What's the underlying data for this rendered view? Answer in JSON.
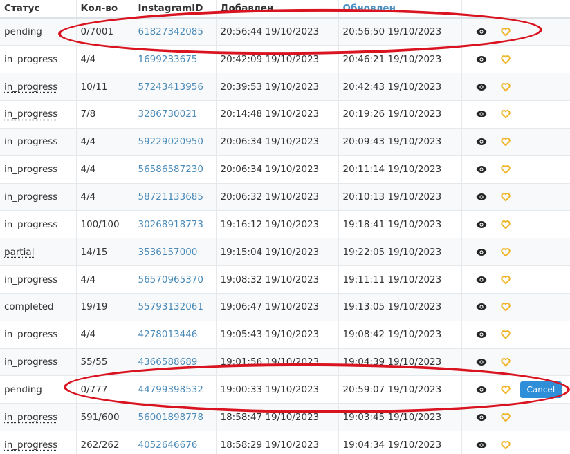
{
  "table": {
    "headers": {
      "status": "Статус",
      "qty": "Кол-во",
      "instagram_id": "InstagramID",
      "added": "Добавлен",
      "updated": "Обновлен"
    },
    "rows": [
      {
        "status": "pending",
        "dotted": false,
        "qty": "0/7001",
        "ig": "61827342085",
        "added": "20:56:44 19/10/2023",
        "updated": "20:56:50 19/10/2023",
        "cancel": false
      },
      {
        "status": "in_progress",
        "dotted": false,
        "qty": "4/4",
        "ig": "1699233675",
        "added": "20:42:09 19/10/2023",
        "updated": "20:46:21 19/10/2023",
        "cancel": false
      },
      {
        "status": "in_progress",
        "dotted": true,
        "qty": "10/11",
        "ig": "57243413956",
        "added": "20:39:53 19/10/2023",
        "updated": "20:42:43 19/10/2023",
        "cancel": false
      },
      {
        "status": "in_progress",
        "dotted": true,
        "qty": "7/8",
        "ig": "3286730021",
        "added": "20:14:48 19/10/2023",
        "updated": "20:19:26 19/10/2023",
        "cancel": false
      },
      {
        "status": "in_progress",
        "dotted": false,
        "qty": "4/4",
        "ig": "59229020950",
        "added": "20:06:34 19/10/2023",
        "updated": "20:09:43 19/10/2023",
        "cancel": false
      },
      {
        "status": "in_progress",
        "dotted": false,
        "qty": "4/4",
        "ig": "56586587230",
        "added": "20:06:34 19/10/2023",
        "updated": "20:11:14 19/10/2023",
        "cancel": false
      },
      {
        "status": "in_progress",
        "dotted": false,
        "qty": "4/4",
        "ig": "58721133685",
        "added": "20:06:32 19/10/2023",
        "updated": "20:10:13 19/10/2023",
        "cancel": false
      },
      {
        "status": "in_progress",
        "dotted": false,
        "qty": "100/100",
        "ig": "30268918773",
        "added": "19:16:12 19/10/2023",
        "updated": "19:18:41 19/10/2023",
        "cancel": false
      },
      {
        "status": "partial",
        "dotted": true,
        "qty": "14/15",
        "ig": "3536157000",
        "added": "19:15:04 19/10/2023",
        "updated": "19:22:05 19/10/2023",
        "cancel": false
      },
      {
        "status": "in_progress",
        "dotted": false,
        "qty": "4/4",
        "ig": "56570965370",
        "added": "19:08:32 19/10/2023",
        "updated": "19:11:11 19/10/2023",
        "cancel": false
      },
      {
        "status": "completed",
        "dotted": false,
        "qty": "19/19",
        "ig": "55793132061",
        "added": "19:06:47 19/10/2023",
        "updated": "19:13:05 19/10/2023",
        "cancel": false
      },
      {
        "status": "in_progress",
        "dotted": false,
        "qty": "4/4",
        "ig": "4278013446",
        "added": "19:05:43 19/10/2023",
        "updated": "19:08:42 19/10/2023",
        "cancel": false
      },
      {
        "status": "in_progress",
        "dotted": false,
        "qty": "55/55",
        "ig": "4366588689",
        "added": "19:01:56 19/10/2023",
        "updated": "19:04:39 19/10/2023",
        "cancel": false
      },
      {
        "status": "pending",
        "dotted": false,
        "qty": "0/777",
        "ig": "44799398532",
        "added": "19:00:33 19/10/2023",
        "updated": "20:59:07 19/10/2023",
        "cancel": true
      },
      {
        "status": "in_progress",
        "dotted": true,
        "qty": "591/600",
        "ig": "56001898778",
        "added": "18:58:47 19/10/2023",
        "updated": "19:03:45 19/10/2023",
        "cancel": false
      },
      {
        "status": "in_progress",
        "dotted": true,
        "qty": "262/262",
        "ig": "4052646676",
        "added": "18:58:29 19/10/2023",
        "updated": "19:04:34 19/10/2023",
        "cancel": false
      }
    ],
    "cancel_label": "Cancel"
  },
  "icons": {
    "view": "eye-icon",
    "favorite": "heart-icon"
  },
  "colors": {
    "link": "#4a8ab8",
    "sorted_header": "#4a90c2",
    "cancel_button": "#2e8fd8",
    "heart": "#f0b429",
    "annotation": "#d9131f"
  }
}
